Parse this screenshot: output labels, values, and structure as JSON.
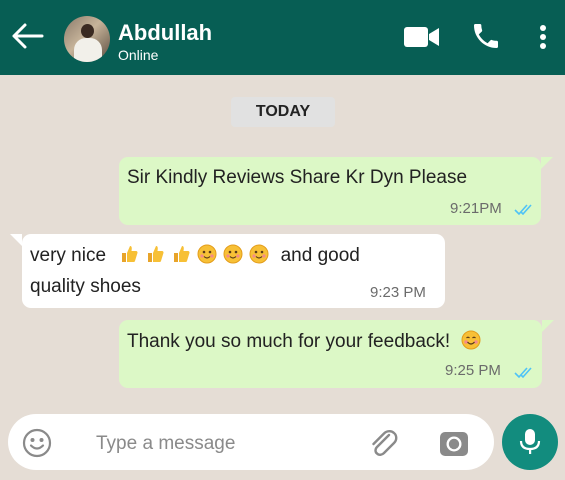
{
  "header": {
    "contact_name": "Abdullah",
    "status": "Online",
    "icons": [
      "back-arrow-icon",
      "video-call-icon",
      "phone-icon",
      "more-options-icon"
    ],
    "bg_color": "#075e54"
  },
  "chat": {
    "day_label": "TODAY",
    "messages": [
      {
        "direction": "outgoing",
        "text": "Sir Kindly Reviews Share Kr Dyn Please",
        "time": "9:21PM",
        "read": true
      },
      {
        "direction": "incoming",
        "line1_start": "very nice",
        "emojis": [
          "thumbs-up",
          "thumbs-up",
          "thumbs-up",
          "smiling-face",
          "smiling-face",
          "smiling-face"
        ],
        "line1_end": "and good",
        "line2": "quality shoes",
        "time": "9:23 PM"
      },
      {
        "direction": "outgoing",
        "text": "Thank you so much for your feedback!",
        "emojis": [
          "smiling-face-blush"
        ],
        "time": "9:25 PM",
        "read": true
      }
    ],
    "outgoing_bubble_color": "#dcf8c6",
    "incoming_bubble_color": "#ffffff",
    "read_tick_color": "#4fc3f7"
  },
  "composer": {
    "placeholder": "Type a message",
    "icons": [
      "emoji-icon",
      "attach-icon",
      "camera-icon",
      "mic-icon"
    ],
    "mic_button_color": "#128c7e"
  }
}
